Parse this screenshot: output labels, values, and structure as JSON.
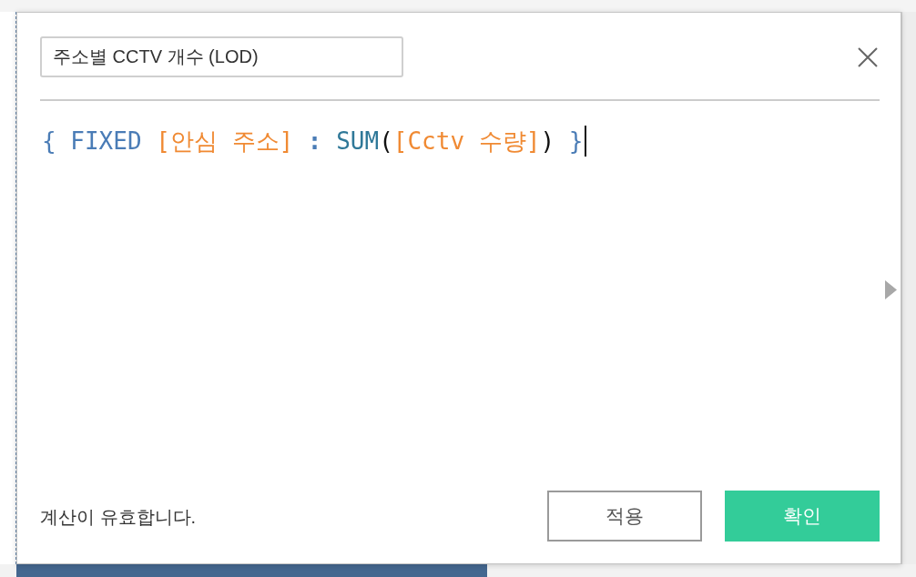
{
  "dialog": {
    "name_field": {
      "value": "주소별 CCTV 개수 (LOD)"
    },
    "formula": {
      "focused": true,
      "tokens": [
        {
          "kind": "keyword",
          "text": "{",
          "space_before": false
        },
        {
          "kind": "keyword",
          "text": "FIXED",
          "space_before": true
        },
        {
          "kind": "field",
          "text": "[안심 주소]",
          "space_before": true
        },
        {
          "kind": "operator",
          "text": ":",
          "space_before": true
        },
        {
          "kind": "function",
          "text": "SUM",
          "space_before": true
        },
        {
          "kind": "paren",
          "text": "(",
          "space_before": false
        },
        {
          "kind": "field",
          "text": "[Cctv 수량]",
          "space_before": false
        },
        {
          "kind": "paren",
          "text": ")",
          "space_before": false
        },
        {
          "kind": "keyword",
          "text": "}",
          "space_before": true
        }
      ]
    },
    "side_panel": {
      "expanded": false
    },
    "status": "계산이 유효합니다.",
    "buttons": [
      {
        "kind": "secondary",
        "label": "적용"
      },
      {
        "kind": "primary",
        "label": "확인"
      }
    ]
  }
}
